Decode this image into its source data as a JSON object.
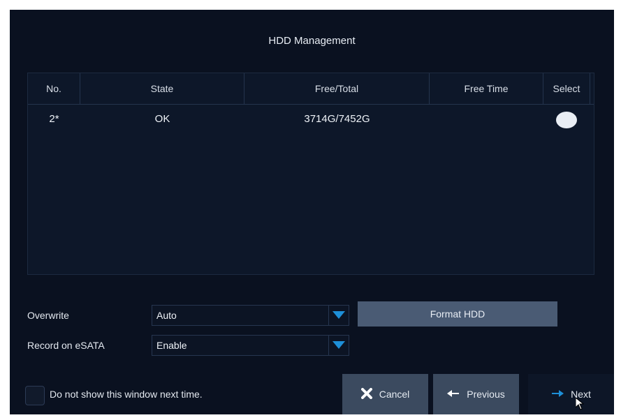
{
  "window": {
    "title": "HDD Management"
  },
  "table": {
    "headers": [
      "No.",
      "State",
      "Free/Total",
      "Free Time",
      "Select"
    ],
    "rows": [
      {
        "no": "2*",
        "state": "OK",
        "free_total": "3714G/7452G",
        "free_time": "",
        "selected": true
      }
    ]
  },
  "overwrite": {
    "label": "Overwrite",
    "value": "Auto"
  },
  "record_esata": {
    "label": "Record on eSATA",
    "value": "Enable"
  },
  "format_button": {
    "label": "Format HDD"
  },
  "dont_show": {
    "label": "Do not show this window next time.",
    "checked": false
  },
  "buttons": {
    "cancel": "Cancel",
    "previous": "Previous",
    "next": "Next"
  },
  "colors": {
    "background": "#0a1120",
    "accent": "#1e8fd8",
    "button": "#3b4a5f",
    "format_button": "#4a5b74"
  },
  "icons": {
    "cancel": "x-mark-icon",
    "previous": "arrow-left-icon",
    "next": "arrow-right-icon",
    "dropdown": "chevron-down-icon"
  }
}
